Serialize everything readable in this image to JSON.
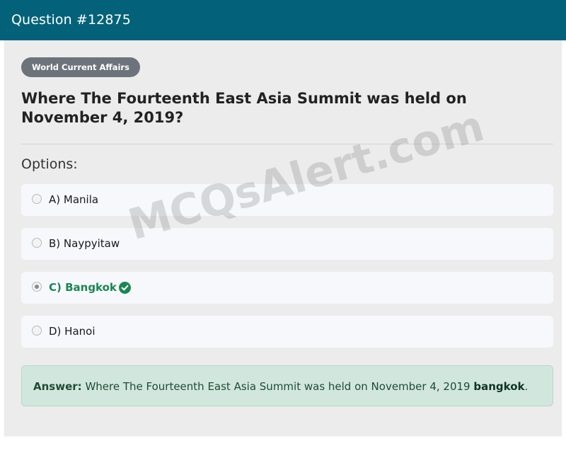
{
  "header": {
    "title": "Question #12875"
  },
  "category_badge": "World Current Affairs",
  "question": "Where The Fourteenth East Asia Summit was held on November 4, 2019?",
  "options_label": "Options:",
  "options": [
    {
      "text": "A) Manila",
      "selected": false,
      "correct": false
    },
    {
      "text": "B) Naypyitaw",
      "selected": false,
      "correct": false
    },
    {
      "text": "C) Bangkok",
      "selected": true,
      "correct": true
    },
    {
      "text": "D) Hanoi",
      "selected": false,
      "correct": false
    }
  ],
  "answer": {
    "label": "Answer:",
    "text": "Where The Fourteenth East Asia Summit was held on November 4, 2019",
    "highlight": "bangkok",
    "suffix": "."
  },
  "watermark": "MCQsAlert.com",
  "colors": {
    "header_bg": "#03627a",
    "correct_green": "#198754",
    "answer_bg": "#d1e7dd"
  },
  "icons": {
    "correct_option": "check-circle-icon"
  }
}
